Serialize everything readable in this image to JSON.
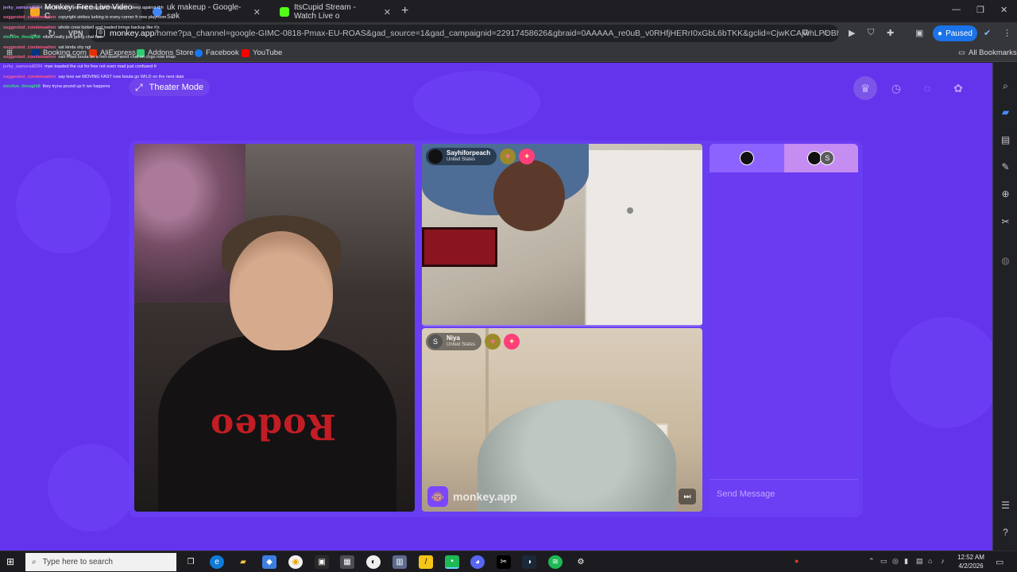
{
  "browser": {
    "tabs": [
      {
        "title": "Monkey: Free Live Video C",
        "active": true,
        "favicon_color": "#f5a623"
      },
      {
        "title": "uk makeup - Google-søk",
        "active": false,
        "favicon_color": "#4285f4"
      },
      {
        "title": "ItsCupid Stream - Watch Live o",
        "active": false,
        "favicon_color": "#53fc18"
      }
    ],
    "url_host": "monkey.app",
    "url_path": "/home?pa_channel=google-GIMC-0818-Pmax-EU-ROAS&gad_source=1&gad_campaignid=22917458626&gbraid=0AAAAA_re0uB_v0RHfjHERrI0xGbL6bTKK&gclid=CjwKCAjwhLPOBhBiEiwA8_wJH...",
    "vpn_label": "VPN",
    "profile_button": "Paused",
    "bookmarks": [
      {
        "label": "Booking.com",
        "color": "#003580"
      },
      {
        "label": "AliExpress",
        "color": "#e62e04"
      },
      {
        "label": "Addons Store",
        "color": "#2ecc71"
      },
      {
        "label": "Facebook",
        "color": "#1877f2"
      },
      {
        "label": "YouTube",
        "color": "#ff0000"
      }
    ],
    "all_bookmarks": "All Bookmarks"
  },
  "overlay_chat": [
    {
      "user": "jerky_samurai8294",
      "user_color": "#b98cff",
      "text": "now they worried bout copyright lmao never sleep against tbh"
    },
    {
      "user": "suggested_condensation",
      "user_color": "#ff5c8a",
      "text": "copyright strikes lurking in every corner fr new playroom"
    },
    {
      "user": "suggested_condensation",
      "user_color": "#ff5c8a",
      "text": "whole crew locked and loaded brings backup like it's"
    },
    {
      "user": "elective_thought8",
      "user_color": "#3ddc84",
      "text": "vibes really just going chat fam"
    },
    {
      "user": "suggested_condensation",
      "user_color": "#ff5c8a",
      "text": "sat kinda shy ngl"
    },
    {
      "user": "suggested_condensation",
      "user_color": "#ff5c8a",
      "text": "nah frfast bouta be a hell-down word chat on ctrgo now imao"
    },
    {
      "user": "jerky_samurai8294",
      "user_color": "#b98cff",
      "text": "man toasted the cut for free not even mad just confused fr"
    },
    {
      "user": "suggested_condensation",
      "user_color": "#ff5c8a",
      "text": "say less we MOVING FAST now bouta go WILD on the next date"
    },
    {
      "user": "elective_thought8",
      "user_color": "#3ddc84",
      "text": "they tryna pound up fr we happens"
    }
  ],
  "page": {
    "theater_mode": "Theater Mode",
    "top_icons": [
      "crown-icon",
      "clock-icon",
      "chat-icon",
      "gift-icon"
    ]
  },
  "videos": {
    "top_right": {
      "name": "Sayhiforpeach",
      "country": "United States",
      "avatar": ""
    },
    "bottom_right": {
      "name": "Niya",
      "country": "United States",
      "avatar": "S"
    },
    "watermark": "monkey.app"
  },
  "chat": {
    "avatars": [
      "",
      "S"
    ],
    "placeholder": "Send Message"
  },
  "taskbar": {
    "search_placeholder": "Type here to search",
    "time": "12:52 AM",
    "date": "4/2/2026"
  }
}
